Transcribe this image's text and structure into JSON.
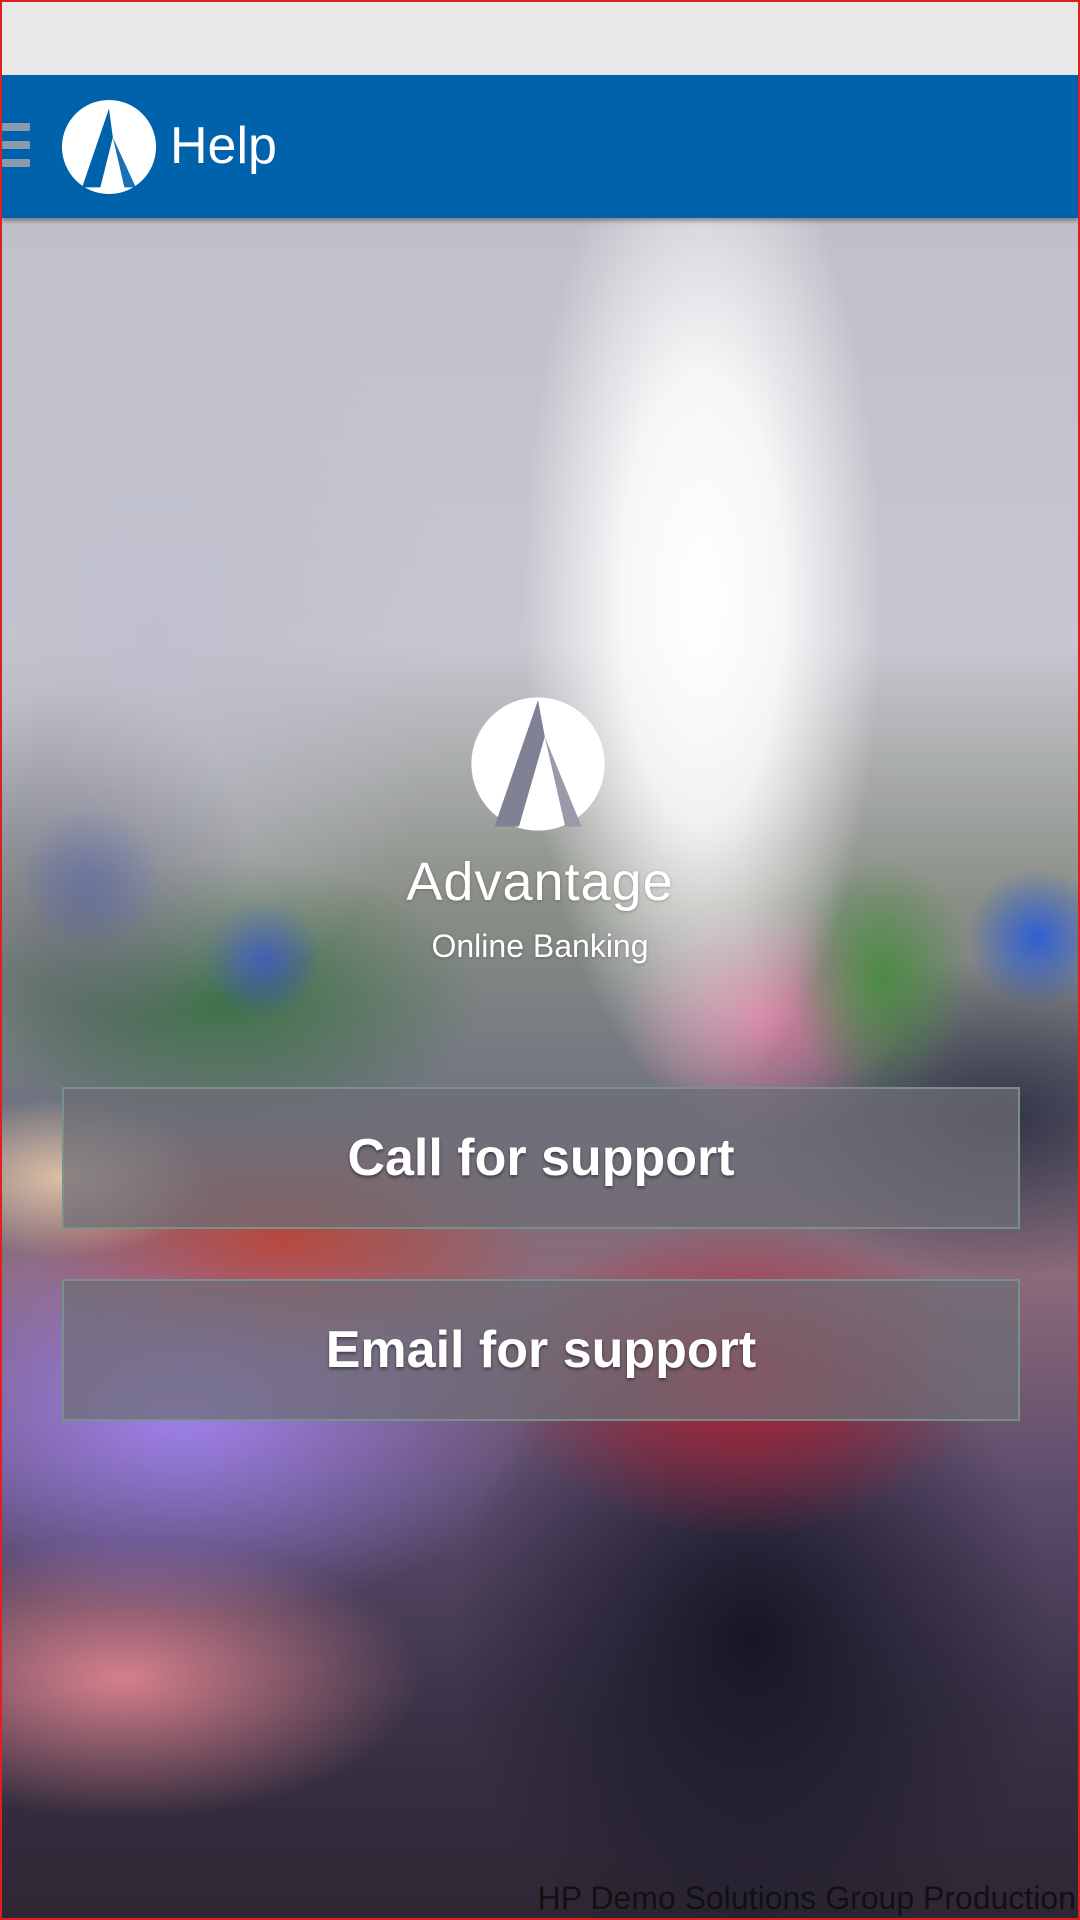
{
  "header": {
    "title": "Help",
    "menu_icon": "hamburger-menu-icon",
    "logo_icon": "advantage-logo-icon",
    "bar_color": "#0062ab"
  },
  "brand": {
    "name": "Advantage",
    "subtitle": "Online Banking",
    "logo_icon": "advantage-logo-icon"
  },
  "actions": {
    "call_label": "Call for support",
    "email_label": "Email for support"
  },
  "footer": {
    "credit": "HP Demo Solutions Group Production"
  }
}
